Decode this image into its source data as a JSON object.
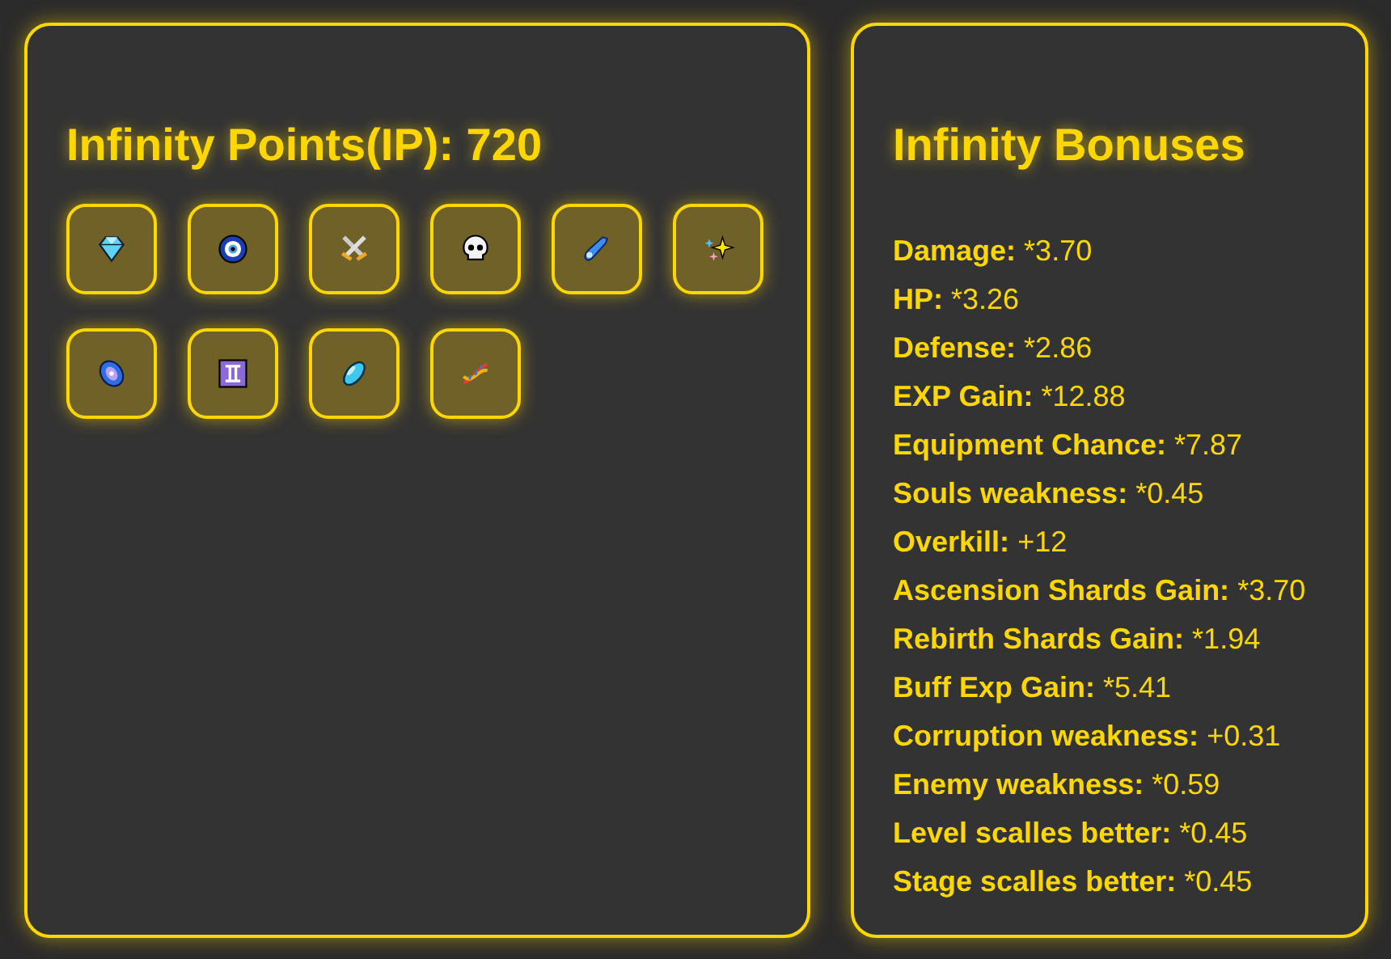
{
  "points_panel": {
    "title": "Infinity Points(IP): 720",
    "upgrades": [
      {
        "kind": "gem"
      },
      {
        "kind": "eye"
      },
      {
        "kind": "swords"
      },
      {
        "kind": "skull"
      },
      {
        "kind": "comet"
      },
      {
        "kind": "sparkles"
      },
      {
        "kind": "galaxy"
      },
      {
        "kind": "gemini"
      },
      {
        "kind": "capsule"
      },
      {
        "kind": "dna"
      }
    ]
  },
  "bonuses_panel": {
    "title": "Infinity Bonuses",
    "bonuses": [
      {
        "label": "Damage:",
        "value": "*3.70"
      },
      {
        "label": "HP:",
        "value": "*3.26"
      },
      {
        "label": "Defense:",
        "value": "*2.86"
      },
      {
        "label": "EXP Gain:",
        "value": "*12.88"
      },
      {
        "label": "Equipment Chance:",
        "value": "*7.87"
      },
      {
        "label": "Souls weakness:",
        "value": "*0.45"
      },
      {
        "label": "Overkill:",
        "value": "+12"
      },
      {
        "label": "Ascension Shards Gain:",
        "value": "*3.70"
      },
      {
        "label": "Rebirth Shards Gain:",
        "value": "*1.94"
      },
      {
        "label": "Buff Exp Gain:",
        "value": "*5.41"
      },
      {
        "label": "Corruption weakness:",
        "value": "+0.31"
      },
      {
        "label": "Enemy weakness:",
        "value": "*0.59"
      },
      {
        "label": "Level scalles better:",
        "value": "*0.45"
      },
      {
        "label": "Stage scalles better:",
        "value": "*0.45"
      }
    ]
  }
}
